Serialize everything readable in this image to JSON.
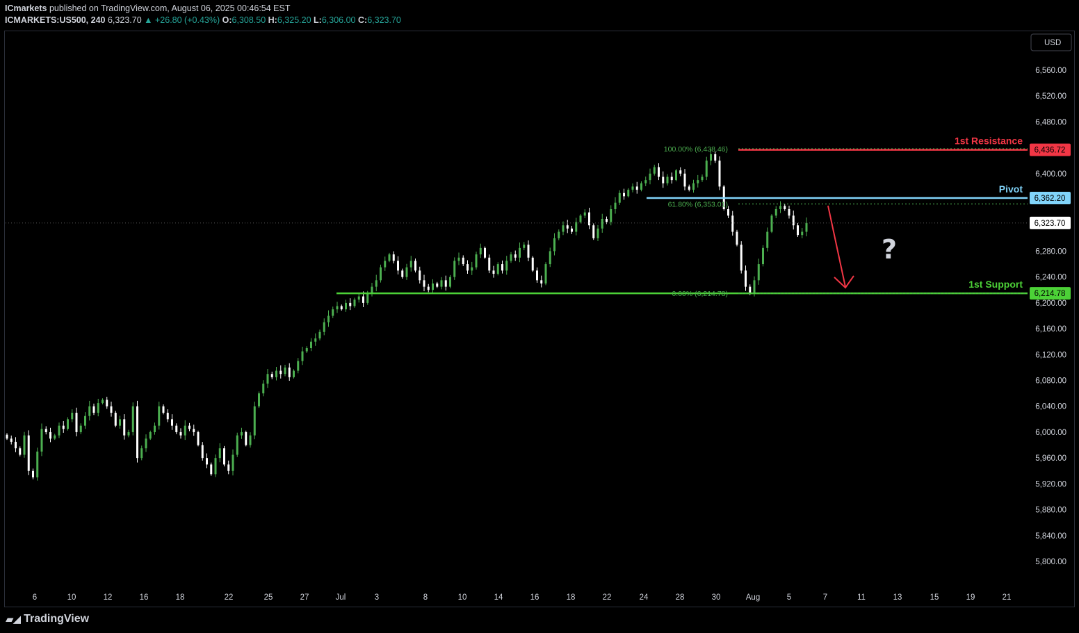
{
  "header": {
    "publisher_name": "ICmarkets",
    "published_text": "published on TradingView.com, August 06, 2025 00:46:54 EST",
    "symbol": "ICMARKETS:US500, 240",
    "last": "6,323.70",
    "change": "+26.80 (+0.43%)",
    "open_label": "O:",
    "open": "6,308.50",
    "high_label": "H:",
    "high": "6,325.20",
    "low_label": "L:",
    "low": "6,306.00",
    "close_label": "C:",
    "close": "6,323.70"
  },
  "currency_button": "USD",
  "footer": {
    "brand": "TradingView",
    "logo_icon": "tradingview-logo-icon"
  },
  "colors": {
    "up": "#4caf50",
    "down": "#ffffff",
    "resistance": "#f23645",
    "pivot": "#81d4fa",
    "support": "#4cd137",
    "fib": "#4caf50",
    "arrow": "#f23645"
  },
  "chart_data": {
    "type": "candlestick",
    "y_axis": {
      "ticks": [
        5800,
        5840,
        5880,
        5920,
        5960,
        6000,
        6040,
        6080,
        6120,
        6160,
        6200,
        6240,
        6280,
        6320,
        6360,
        6400,
        6440,
        6480,
        6520,
        6560
      ],
      "tick_labels": [
        "5,800.00",
        "5,840.00",
        "5,880.00",
        "5,920.00",
        "5,960.00",
        "6,000.00",
        "6,040.00",
        "6,080.00",
        "6,120.00",
        "6,160.00",
        "6,200.00",
        "6,240.00",
        "6,280.00",
        "",
        "",
        "6,400.00",
        "",
        "6,480.00",
        "6,520.00",
        "6,560.00"
      ]
    },
    "x_axis": {
      "tick_labels": [
        "6",
        "10",
        "12",
        "16",
        "18",
        "22",
        "25",
        "27",
        "Jul",
        "3",
        "8",
        "10",
        "14",
        "16",
        "18",
        "22",
        "24",
        "28",
        "30",
        "Aug",
        "5",
        "7",
        "11",
        "13",
        "15",
        "19",
        "21"
      ]
    },
    "levels": [
      {
        "name": "1st Resistance",
        "value": 6436.72,
        "value_label": "6,436.72",
        "color": "#f23645"
      },
      {
        "name": "Pivot",
        "value": 6362.2,
        "value_label": "6,362.20",
        "color": "#81d4fa"
      },
      {
        "name": "1st Support",
        "value": 6214.78,
        "value_label": "6,214.78",
        "color": "#4cd137"
      }
    ],
    "last_price": {
      "value": 6323.7,
      "value_label": "6,323.70"
    },
    "fibonacci": [
      {
        "label": "100.00% (6,438.46)",
        "value": 6438.46
      },
      {
        "label": "61.80% (6,353.01)",
        "value": 6353.01
      },
      {
        "label": "0.00% (6,214.78)",
        "value": 6214.78
      }
    ],
    "annotation": "?",
    "price_path": [
      5990,
      5985,
      5975,
      5965,
      5995,
      5940,
      5930,
      5970,
      6005,
      6000,
      5990,
      5995,
      6010,
      6005,
      6020,
      6030,
      6000,
      6010,
      6025,
      6040,
      6030,
      6045,
      6050,
      6040,
      6030,
      6010,
      6020,
      5995,
      6000,
      6040,
      5960,
      5975,
      5990,
      6000,
      6010,
      6040,
      6030,
      6020,
      6010,
      6000,
      5995,
      6010,
      6005,
      6000,
      5980,
      5960,
      5950,
      5935,
      5960,
      5975,
      5950,
      5940,
      5965,
      5995,
      6000,
      5980,
      5995,
      6040,
      6060,
      6075,
      6090,
      6085,
      6095,
      6090,
      6100,
      6085,
      6095,
      6110,
      6125,
      6130,
      6140,
      6145,
      6155,
      6170,
      6180,
      6190,
      6195,
      6190,
      6200,
      6195,
      6205,
      6210,
      6200,
      6215,
      6225,
      6235,
      6255,
      6265,
      6275,
      6265,
      6250,
      6240,
      6255,
      6265,
      6250,
      6235,
      6225,
      6220,
      6230,
      6225,
      6235,
      6225,
      6240,
      6265,
      6270,
      6260,
      6250,
      6255,
      6275,
      6285,
      6270,
      6250,
      6245,
      6260,
      6250,
      6265,
      6275,
      6270,
      6285,
      6290,
      6270,
      6250,
      6235,
      6230,
      6260,
      6280,
      6300,
      6310,
      6320,
      6315,
      6310,
      6325,
      6335,
      6340,
      6320,
      6300,
      6315,
      6330,
      6325,
      6345,
      6355,
      6370,
      6365,
      6375,
      6380,
      6375,
      6385,
      6390,
      6400,
      6410,
      6395,
      6385,
      6395,
      6390,
      6405,
      6400,
      6380,
      6375,
      6385,
      6390,
      6395,
      6420,
      6430,
      6420,
      6380,
      6345,
      6335,
      6310,
      6290,
      6250,
      6225,
      6215,
      6235,
      6260,
      6285,
      6310,
      6335,
      6345,
      6350,
      6345,
      6335,
      6320,
      6305,
      6310,
      6323.7
    ]
  }
}
